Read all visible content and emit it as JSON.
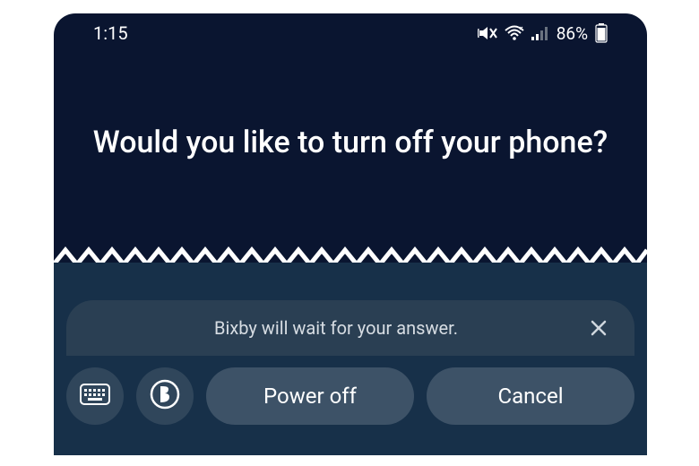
{
  "status": {
    "time": "1:15",
    "battery_percent": "86%",
    "icons": {
      "mute_vibrate": "mute-vibrate-icon",
      "wifi": "wifi-icon",
      "signal": "signal-icon",
      "battery": "battery-icon"
    }
  },
  "prompt": {
    "text": "Would you like to turn off your phone?"
  },
  "toast": {
    "message": "Bixby will wait for your answer.",
    "close_label": "Close"
  },
  "actions": {
    "keyboard_label": "Keyboard",
    "bixby_label": "Bixby",
    "power_off": "Power off",
    "cancel": "Cancel"
  },
  "colors": {
    "upper_bg": "#0a1530",
    "lower_bg": "#173049",
    "toast_bg": "#2a3f53",
    "pill_bg": "#3d5267",
    "circle_bg": "#30465b"
  }
}
